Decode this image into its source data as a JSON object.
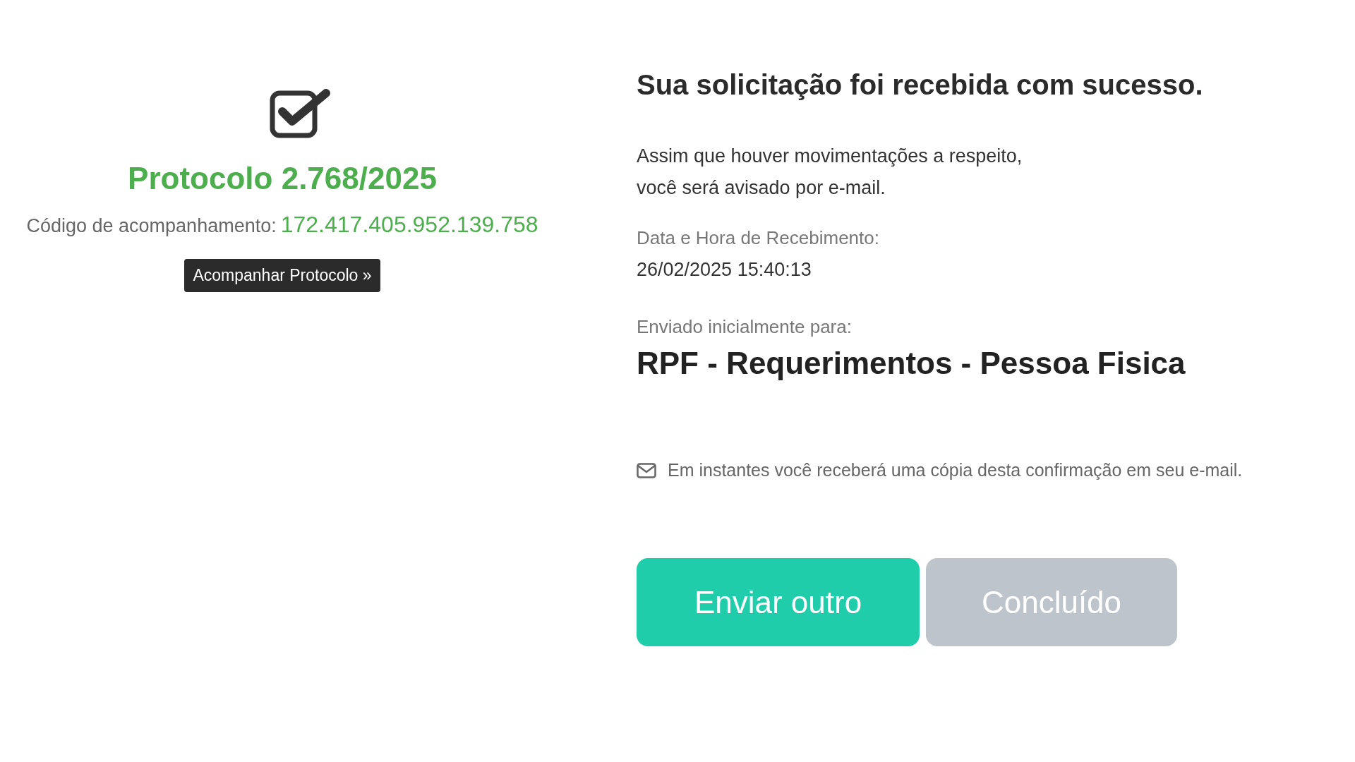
{
  "protocol": {
    "title": "Protocolo 2.768/2025",
    "tracking_label": "Código de acompanhamento:",
    "tracking_code": "172.417.405.952.139.758",
    "button": "Acompanhar Protocolo »"
  },
  "confirmation": {
    "heading": "Sua solicitação foi recebida com sucesso.",
    "message_lines": [
      "Assim que houver movimentações a respeito,",
      "você será avisado por e-mail."
    ],
    "received_label": "Data e Hora de Recebimento:",
    "received_value": "26/02/2025 15:40:13",
    "sent_label": "Enviado inicialmente para:",
    "sent_value": "RPF - Requerimentos - Pessoa Fisica",
    "email_note": "Em instantes você receberá uma cópia desta confirmação em seu e-mail."
  },
  "buttons": [
    {
      "label": "Enviar outro",
      "disabled": false
    },
    {
      "label": "Concluído",
      "disabled": true
    }
  ]
}
